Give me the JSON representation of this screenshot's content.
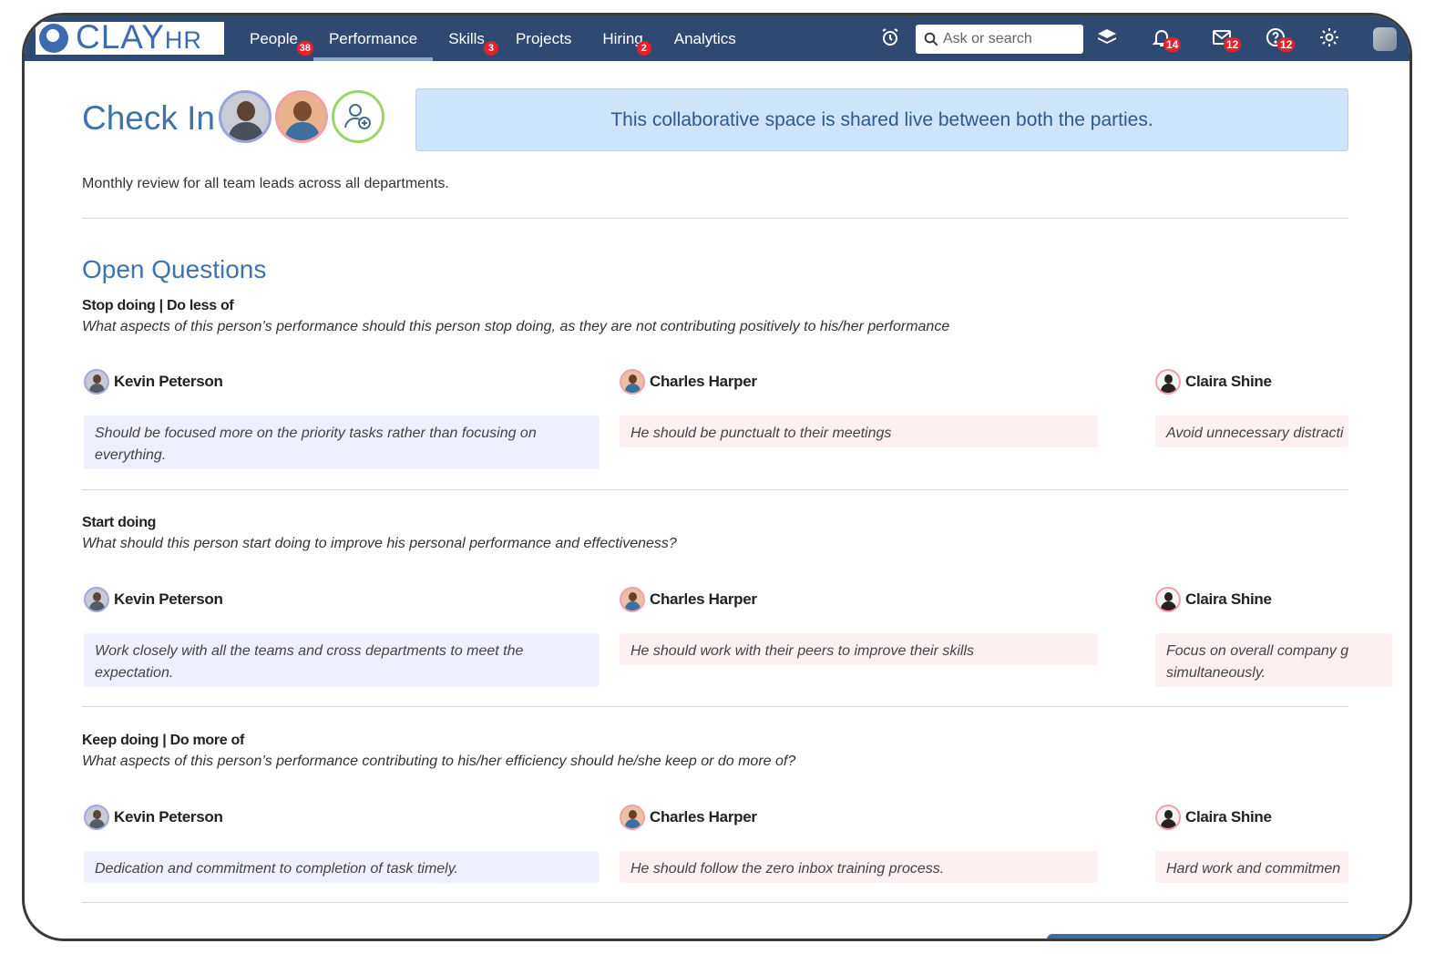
{
  "app": {
    "logo_text": "CLAY",
    "logo_sub": "HR"
  },
  "nav": [
    {
      "label": "People",
      "badge": "38",
      "active": false
    },
    {
      "label": "Performance",
      "badge": "",
      "active": true
    },
    {
      "label": "Skills",
      "badge": "3",
      "active": false
    },
    {
      "label": "Projects",
      "badge": "",
      "active": false
    },
    {
      "label": "Hiring",
      "badge": "2",
      "active": false
    },
    {
      "label": "Analytics",
      "badge": "",
      "active": false
    }
  ],
  "search": {
    "placeholder": "Ask or search"
  },
  "toolbar": {
    "notifications_badge": "14",
    "messages_badge": "12",
    "help_badge": "12"
  },
  "page": {
    "title": "Check In",
    "banner": "This collaborative space is shared live between both the parties.",
    "subtitle": "Monthly  review for all team leads across all departments.",
    "section_title": "Open Questions"
  },
  "questions": [
    {
      "title": "Stop doing | Do less of",
      "description": "What aspects of this person’s performance should this person stop doing, as they are not contributing positively to his/her performance",
      "answers": [
        {
          "name": "Kevin Peterson",
          "text": "Should be focused more on the priority tasks rather than focusing on everything."
        },
        {
          "name": "Charles Harper",
          "text": "He should be punctualt to their meetings"
        },
        {
          "name": "Claira Shine",
          "text": "Avoid unnecessary distracti"
        }
      ]
    },
    {
      "title": "Start doing",
      "description": "What should this person start doing to improve his personal performance and effectiveness?",
      "answers": [
        {
          "name": "Kevin Peterson",
          "text": "Work closely with all the teams and cross departments to meet the expectation."
        },
        {
          "name": "Charles Harper",
          "text": "He should work with their peers to improve their skills"
        },
        {
          "name": "Claira Shine",
          "text": "Focus on overall company g simultaneously."
        }
      ]
    },
    {
      "title": "Keep doing | Do more of",
      "description": "What aspects of this person’s performance contributing to his/her efficiency should he/she keep or do more of?",
      "answers": [
        {
          "name": "Kevin Peterson",
          "text": "Dedication and commitment to completion of task timely."
        },
        {
          "name": "Charles Harper",
          "text": "He should follow the zero inbox training process."
        },
        {
          "name": "Claira Shine",
          "text": "Hard work and commitmen"
        }
      ]
    }
  ],
  "colors": {
    "topbar": "#2e4a72",
    "accent": "#3f73ad",
    "banner_bg": "#cde4fb",
    "badge": "#e8202a",
    "response_blue": "#eef0fd",
    "response_pink": "#fdf0f0"
  }
}
